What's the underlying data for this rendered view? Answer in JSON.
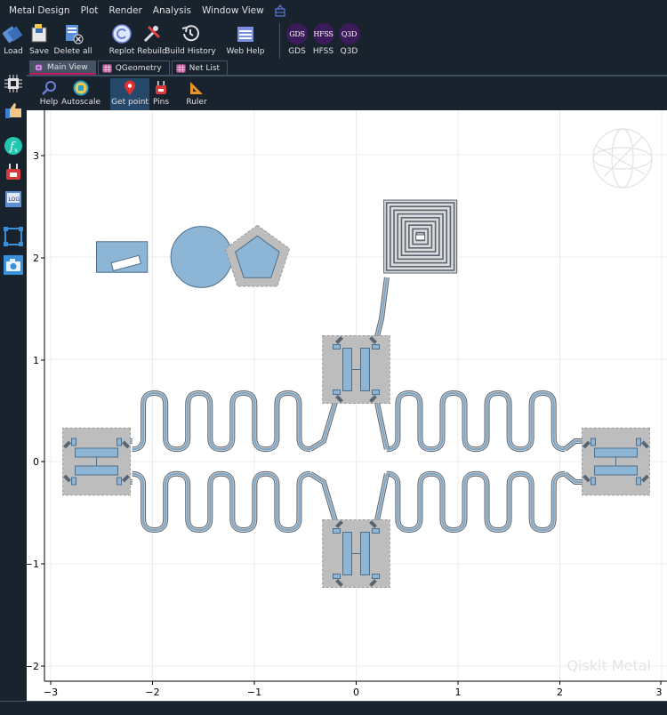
{
  "menu": [
    "Metal Design",
    "Plot",
    "Render",
    "Analysis",
    "Window View"
  ],
  "toolbar": {
    "load": "Load",
    "save": "Save",
    "delete_all": "Delete all",
    "replot": "Replot",
    "rebuild": "Rebuild",
    "build_history": "Build History",
    "web_help": "Web Help",
    "gds": "GDS",
    "hfss": "HFSS",
    "q3d": "Q3D",
    "gds_badge": "GDS",
    "hfss_badge": "HFSS",
    "q3d_badge": "Q3D"
  },
  "tabs": [
    "Main View",
    "QGeometry",
    "Net List"
  ],
  "subtoolbar": {
    "help": "Help",
    "autoscale": "Autoscale",
    "get_point": "Get point",
    "pins": "Pins",
    "ruler": "Ruler"
  },
  "plot": {
    "x_ticks": [
      "−3",
      "−2",
      "−1",
      "0",
      "1",
      "2",
      "3"
    ],
    "y_ticks": [
      "3",
      "2",
      "1",
      "0",
      "−1",
      "−2"
    ],
    "xlim": [
      -3,
      3
    ],
    "ylim": [
      -2.2,
      3.3
    ],
    "grid": true,
    "watermark": "Qiskit Metal"
  },
  "colors": {
    "app_bg": "#19232d",
    "accent_tab": "#c2185b",
    "component_fill": "#8db6d6",
    "component_edge": "#4e6e8a",
    "keepout_gray": "#a9a9a9"
  }
}
